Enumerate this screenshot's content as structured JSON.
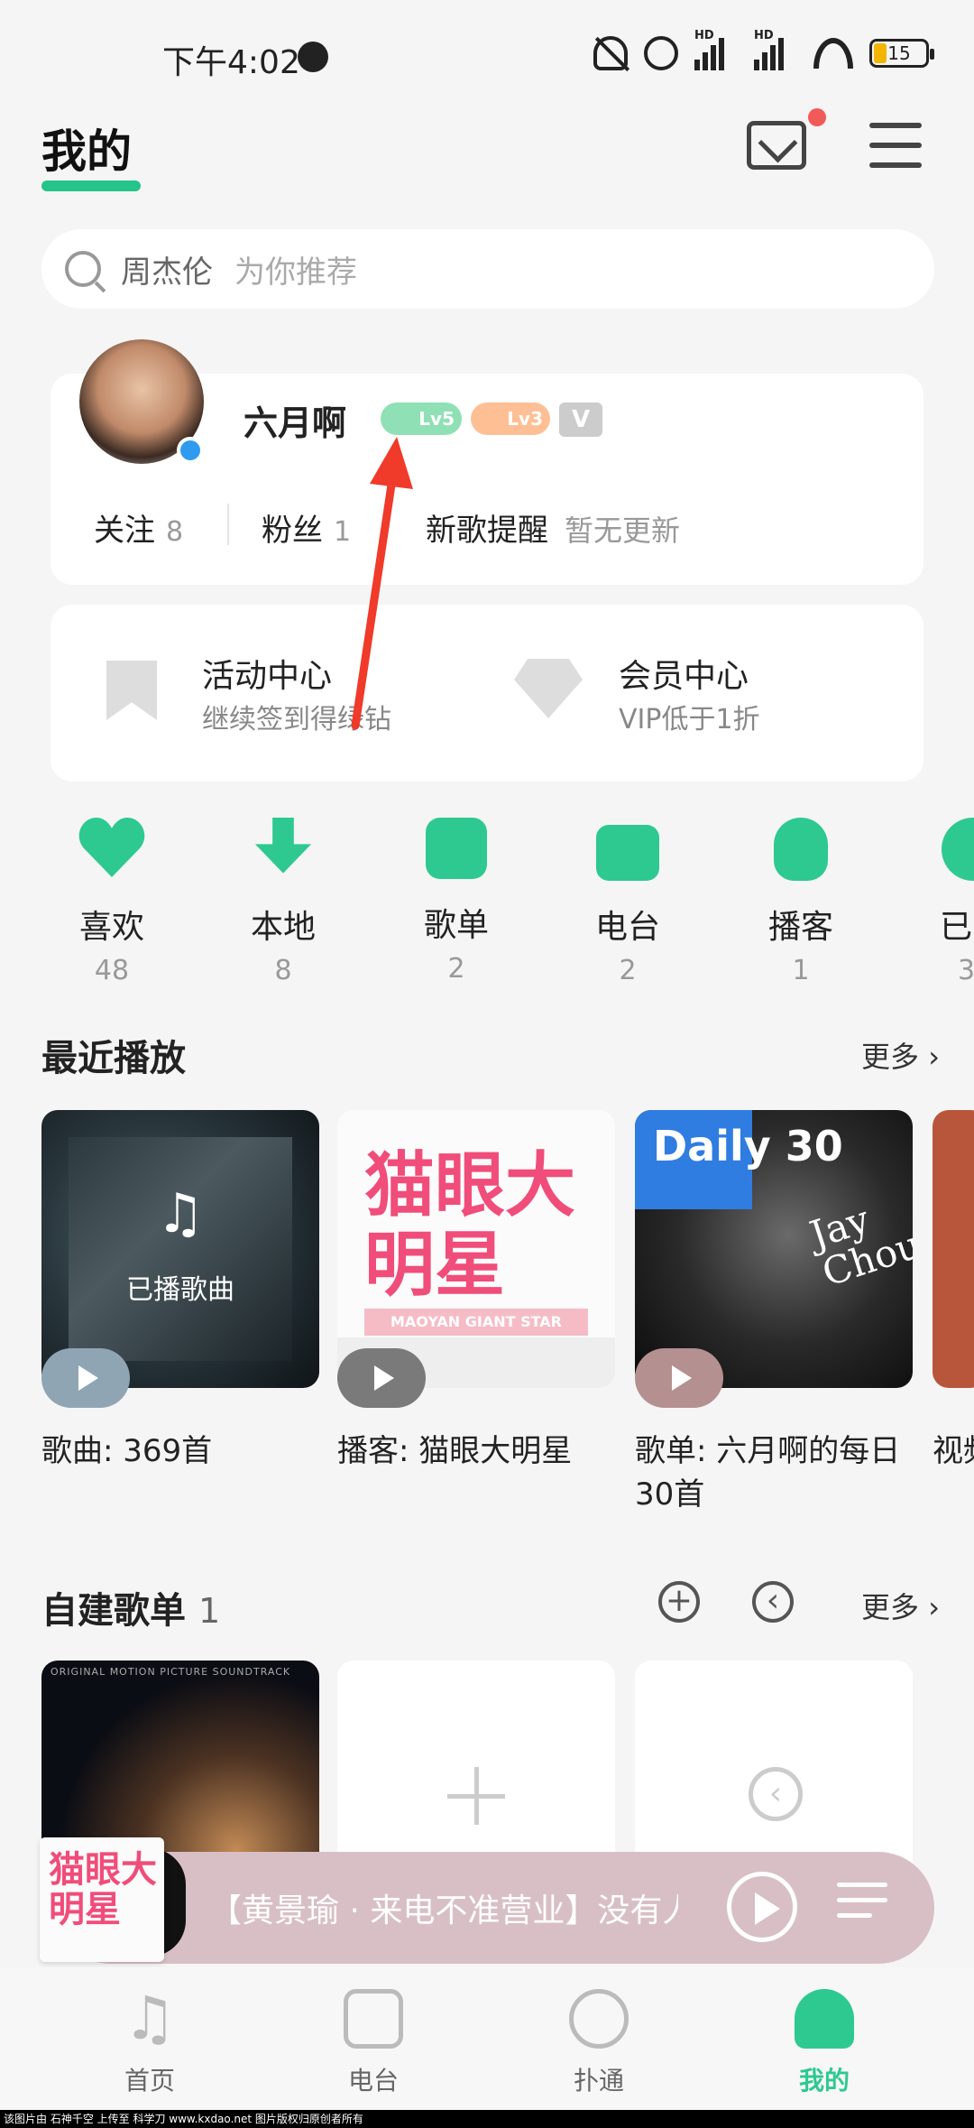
{
  "status": {
    "time": "下午4:02",
    "hd1": "HD",
    "hd2": "HD",
    "battery": "15"
  },
  "header": {
    "title": "我的"
  },
  "search": {
    "keyword": "周杰伦",
    "hint": "为你推荐"
  },
  "profile": {
    "name": "六月啊",
    "badges": [
      "Lv5",
      "Lv3",
      "V"
    ],
    "stats": [
      {
        "label": "关注",
        "count": "8"
      },
      {
        "label": "粉丝",
        "count": "1"
      }
    ],
    "new_song_label": "新歌提醒",
    "new_song_note": "暂无更新"
  },
  "activity": {
    "left_title": "活动中心",
    "left_sub": "继续签到得绿钻",
    "right_title": "会员中心",
    "right_sub": "VIP低于1折"
  },
  "quick_links": [
    {
      "label": "喜欢",
      "count": "48",
      "icon": "heart-icon"
    },
    {
      "label": "本地",
      "count": "8",
      "icon": "download-icon"
    },
    {
      "label": "歌单",
      "count": "2",
      "icon": "playlist-icon"
    },
    {
      "label": "电台",
      "count": "2",
      "icon": "radio-icon"
    },
    {
      "label": "播客",
      "count": "1",
      "icon": "podcast-icon"
    },
    {
      "label": "已",
      "count": "3",
      "icon": "purchased-icon"
    }
  ],
  "recent": {
    "title": "最近播放",
    "more": "更多",
    "items": [
      {
        "cover_text": "已播歌曲",
        "caption": "歌曲: 369首"
      },
      {
        "cover_title": "猫眼大明星",
        "cover_band": "MAOYAN GIANT STAR",
        "caption": "播客: 猫眼大明星"
      },
      {
        "cover_title": "Daily 30",
        "cover_artist": "Jay Chou",
        "caption": "歌单: 六月啊的每日30首"
      },
      {
        "caption": "视频"
      }
    ]
  },
  "playlists": {
    "title": "自建歌单",
    "count": "1",
    "more": "更多",
    "cover_text": "ORIGINAL MOTION PICTURE SOUNDTRACK"
  },
  "player": {
    "now_playing": "【黄景瑜 · 来电不准营业】没有人",
    "cover_title": "猫眼大明星"
  },
  "nav": [
    {
      "label": "首页",
      "active": false
    },
    {
      "label": "电台",
      "active": false
    },
    {
      "label": "扑通",
      "active": false
    },
    {
      "label": "我的",
      "active": true
    }
  ],
  "watermark": "该图片由 石神千空 上传至 科学刀 www.kxdao.net 图片版权归原创者所有",
  "colors": {
    "accent": "#2ec990",
    "annotation": "#f03a2a",
    "mail_dot": "#f25a5a"
  }
}
